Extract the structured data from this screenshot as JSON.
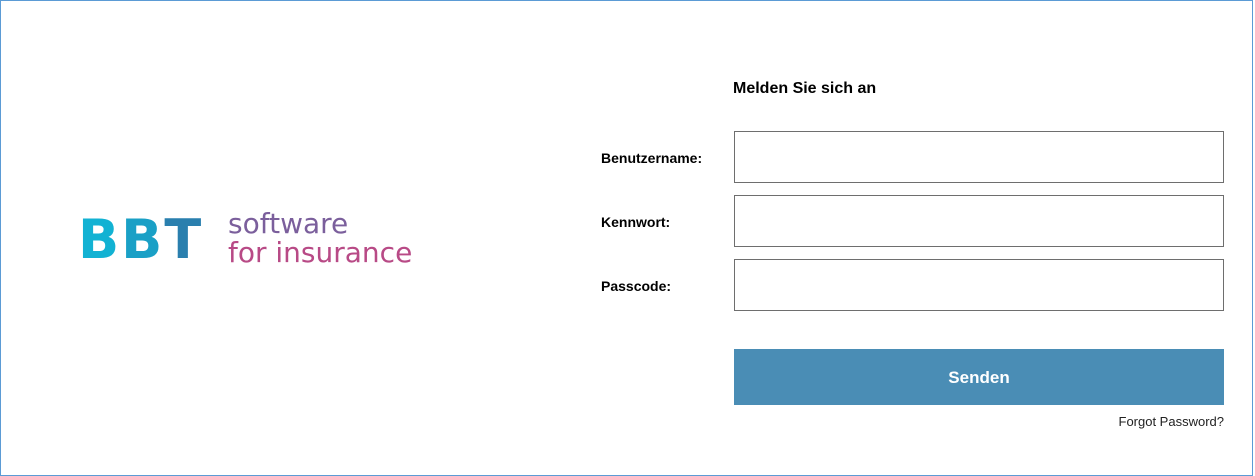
{
  "logo": {
    "mark": "BBT",
    "line1": "software",
    "line2": "for insurance",
    "colors": {
      "b1": "#12b2d3",
      "b2": "#1aa0c6",
      "t": "#2a7fae",
      "line1": "#7b5f9c",
      "line2": "#b84a86"
    }
  },
  "form": {
    "title": "Melden Sie sich an",
    "fields": [
      {
        "label": "Benutzername:",
        "value": "",
        "placeholder": ""
      },
      {
        "label": "Kennwort:",
        "value": "",
        "placeholder": ""
      },
      {
        "label": "Passcode:",
        "value": "",
        "placeholder": ""
      }
    ],
    "submit_label": "Senden",
    "forgot_label": "Forgot Password?"
  },
  "colors": {
    "accent": "#4a8db5",
    "frame_border": "#5b9bd5"
  }
}
